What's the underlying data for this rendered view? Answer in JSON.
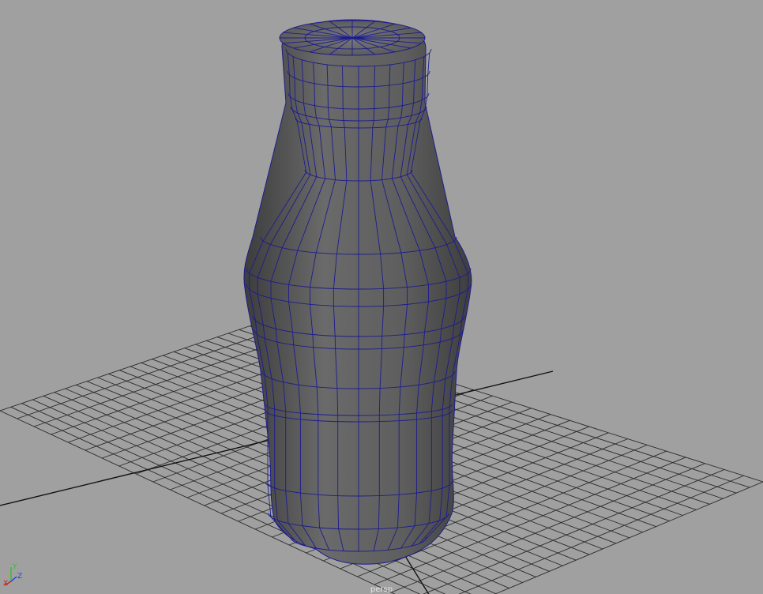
{
  "viewport": {
    "camera_name": "persp",
    "background_color": "#a0a0a0",
    "grid_color": "#2a2a2a",
    "mesh_fill_color": "#5a5a5a",
    "wireframe_color": "#1c1c8e"
  },
  "axis_gizmo": {
    "x_label": "X",
    "y_label": "Y",
    "z_label": "Z",
    "x_color": "#c82020",
    "y_color": "#30c030",
    "z_color": "#2040e0"
  },
  "scene_object": {
    "icon": "bottle-mesh-icon",
    "type": "polygon-mesh"
  }
}
